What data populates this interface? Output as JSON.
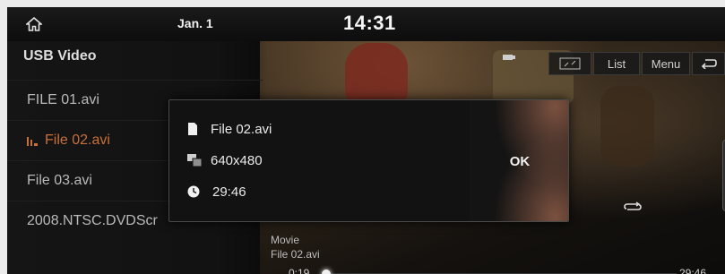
{
  "statusbar": {
    "date": "Jan. 1",
    "time": "14:31",
    "home_icon": "home-icon"
  },
  "sidebar": {
    "title": "USB Video",
    "files": [
      {
        "label": "FILE 01.avi",
        "active": false
      },
      {
        "label": "File 02.avi",
        "active": true,
        "icon": "playing-equalizer-icon"
      },
      {
        "label": "File 03.avi",
        "active": false
      },
      {
        "label": "2008.NTSC.DVDScr",
        "active": false
      }
    ]
  },
  "video": {
    "controls": {
      "fullscreen_icon": "fullscreen-icon",
      "list_label": "List",
      "menu_label": "Menu",
      "back_icon": "back-icon"
    },
    "category": "Movie",
    "file_name": "File 02.avi",
    "elapsed": "0:19",
    "duration": "29:46",
    "progress_fraction": 0.011
  },
  "popup": {
    "file_name": "File 02.avi",
    "resolution": "640x480",
    "length": "29:46",
    "ok_label": "OK"
  },
  "colors": {
    "active_item": "#c9703a",
    "background": "#0b0b0b"
  }
}
